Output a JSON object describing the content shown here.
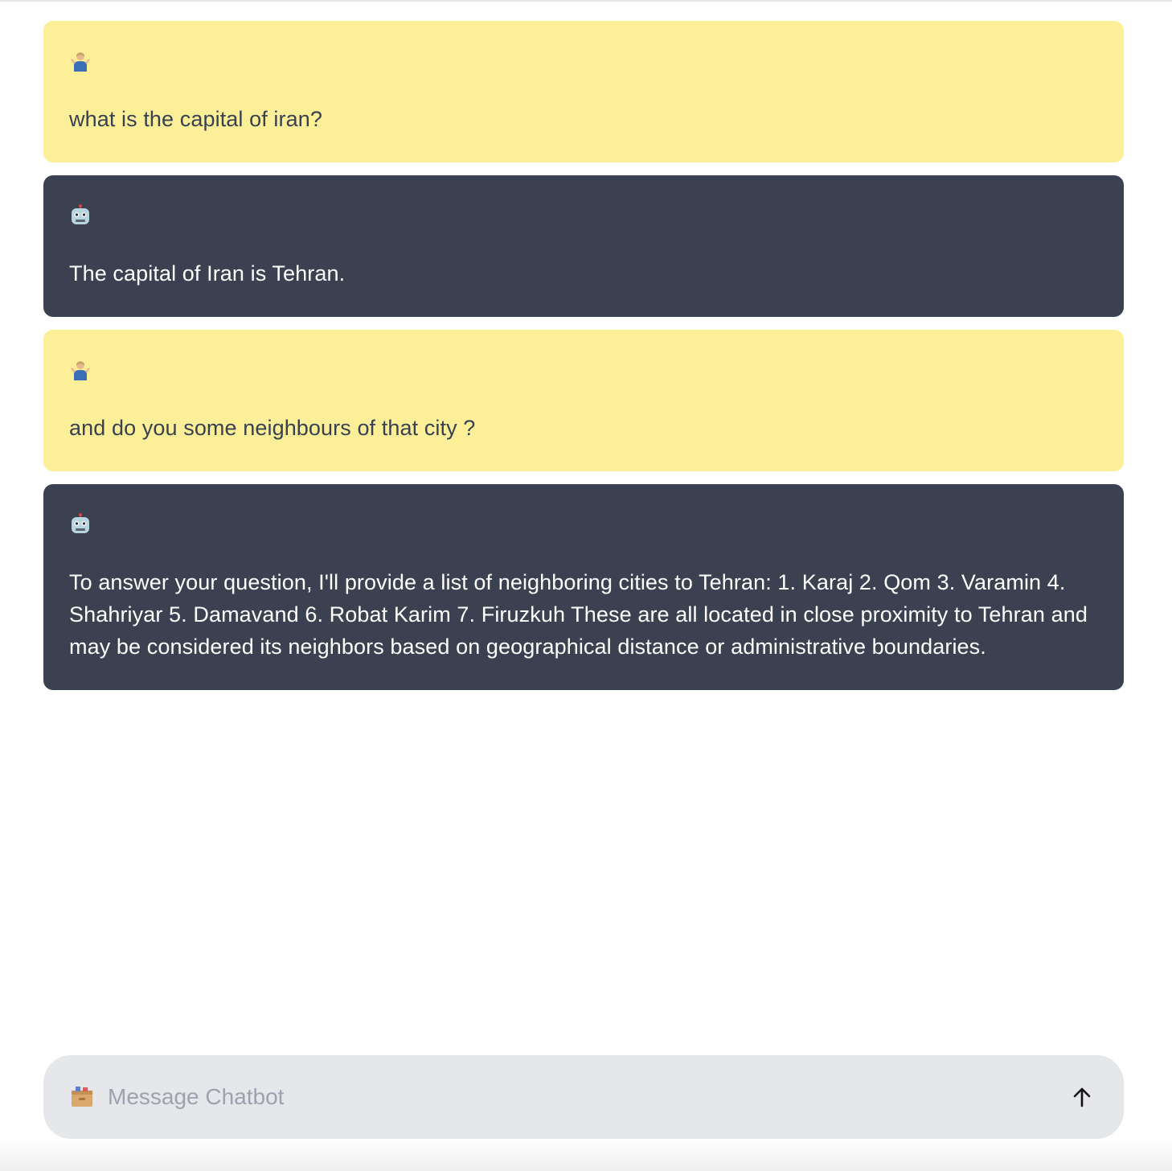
{
  "conversation": {
    "messages": [
      {
        "role": "user",
        "avatar_icon": "shrugging-person-icon",
        "text": "what is the capital of iran?"
      },
      {
        "role": "bot",
        "avatar_icon": "robot-icon",
        "text": "The capital of Iran is Tehran."
      },
      {
        "role": "user",
        "avatar_icon": "shrugging-person-icon",
        "text": "and do you some neighbours of that city ?"
      },
      {
        "role": "bot",
        "avatar_icon": "robot-icon",
        "text": "To answer your question, I'll provide a list of neighboring cities to Tehran: 1. Karaj 2. Qom 3. Varamin 4. Shahriyar 5. Damavand 6. Robat Karim 7. Firuzkuh These are all located in close proximity to Tehran and may be considered its neighbors based on geographical distance or administrative boundaries."
      }
    ]
  },
  "composer": {
    "placeholder": "Message Chatbot",
    "value": "",
    "attach_icon": "card-file-box-icon",
    "send_icon": "arrow-up-icon"
  },
  "colors": {
    "user_bubble": "#fdef98",
    "bot_bubble": "#3b4150",
    "composer_bg": "#e5e7eb"
  }
}
